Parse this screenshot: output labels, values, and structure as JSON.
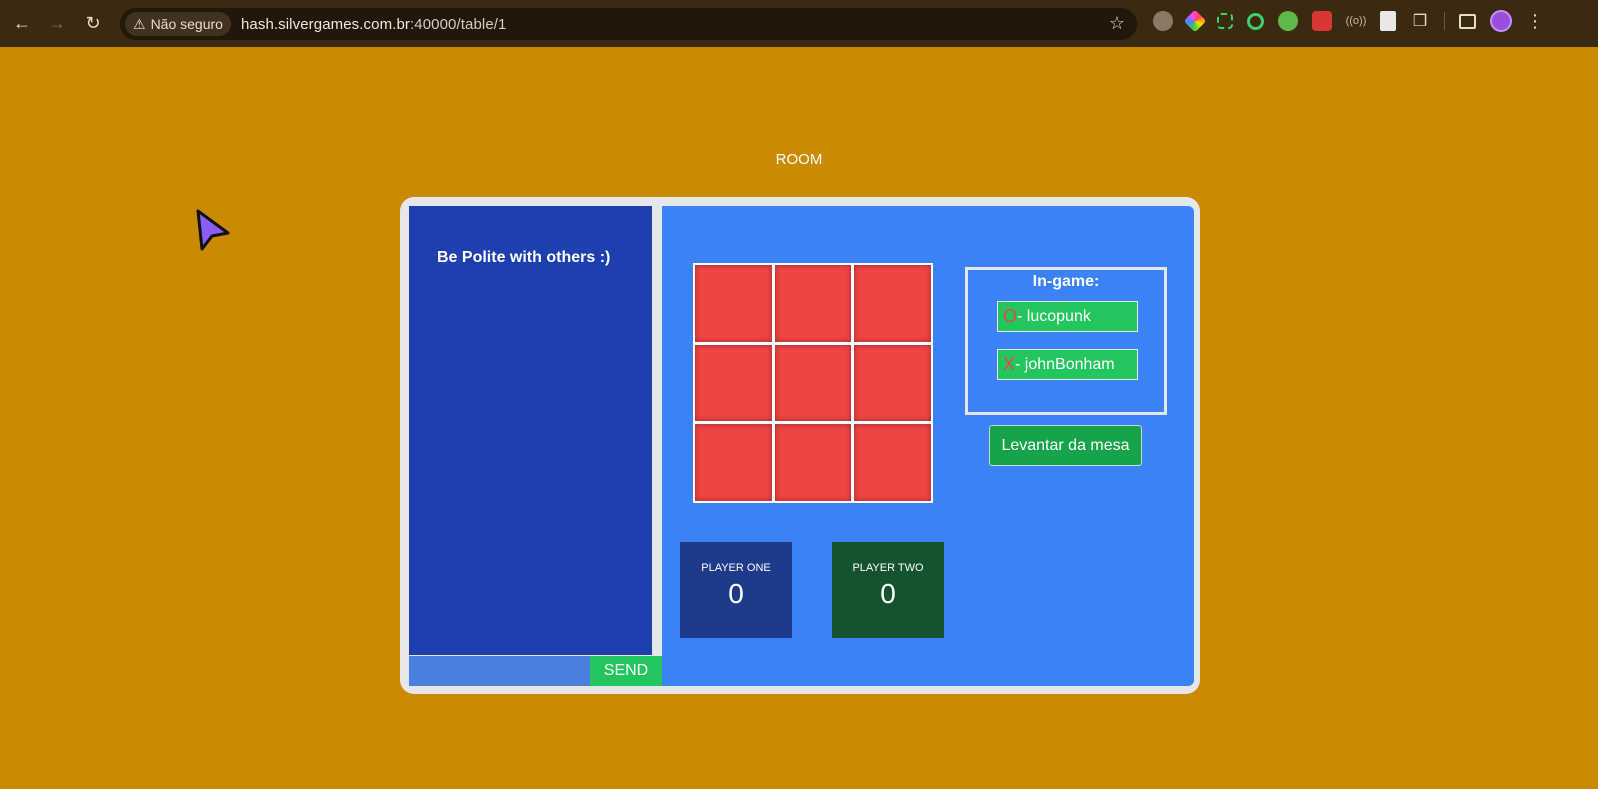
{
  "browser": {
    "security_label": "Não seguro",
    "url_host": "hash.silvergames.com.br",
    "url_path": ":40000/table/1"
  },
  "page": {
    "room_title": "ROOM"
  },
  "chat": {
    "rule_text": "Be Polite with others :)",
    "input_value": "",
    "send_label": "SEND"
  },
  "board": {
    "cells": [
      "",
      "",
      "",
      "",
      "",
      "",
      "",
      "",
      ""
    ]
  },
  "ingame": {
    "title": "In-game:",
    "players": [
      {
        "mark": "O",
        "name": "- lucopunk"
      },
      {
        "mark": "X",
        "name": "- johnBonham"
      }
    ]
  },
  "leave_button": "Levantar da mesa",
  "scores": {
    "player_one": {
      "label": "PLAYER ONE",
      "value": "0"
    },
    "player_two": {
      "label": "PLAYER TWO",
      "value": "0"
    }
  },
  "colors": {
    "page_bg": "#ca8a04",
    "chat_bg": "#1e40af",
    "game_bg": "#3b82f6",
    "cell": "#ef4444",
    "green": "#22c55e",
    "player_one_bg": "#1e3a8a",
    "player_two_bg": "#14532d"
  }
}
